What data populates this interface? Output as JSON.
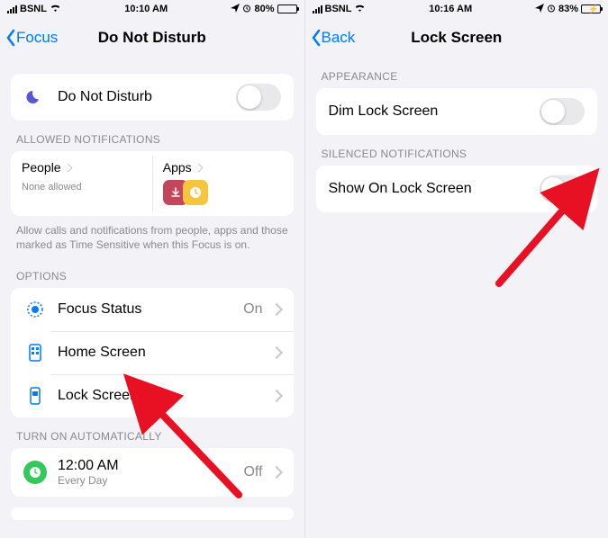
{
  "left": {
    "status": {
      "carrier": "BSNL",
      "time": "10:10 AM",
      "batt": "80%",
      "batt_fill": 80
    },
    "nav": {
      "back": "Focus",
      "title": "Do Not Disturb"
    },
    "main_toggle": {
      "label": "Do Not Disturb"
    },
    "allowed": {
      "header": "ALLOWED NOTIFICATIONS",
      "people": {
        "title": "People",
        "sub": "None allowed"
      },
      "apps": {
        "title": "Apps"
      },
      "footer": "Allow calls and notifications from people, apps and those marked as Time Sensitive when this Focus is on."
    },
    "options": {
      "header": "OPTIONS",
      "focus_status": {
        "label": "Focus Status",
        "value": "On"
      },
      "home": {
        "label": "Home Screen"
      },
      "lock": {
        "label": "Lock Screen"
      }
    },
    "auto": {
      "header": "TURN ON AUTOMATICALLY",
      "sched": {
        "label": "12:00 AM",
        "sub": "Every Day",
        "value": "Off"
      }
    }
  },
  "right": {
    "status": {
      "carrier": "BSNL",
      "time": "10:16 AM",
      "batt": "83%",
      "batt_fill": 83
    },
    "nav": {
      "back": "Back",
      "title": "Lock Screen"
    },
    "appearance": {
      "header": "APPEARANCE",
      "dim": {
        "label": "Dim Lock Screen"
      }
    },
    "silenced": {
      "header": "SILENCED NOTIFICATIONS",
      "show": {
        "label": "Show On Lock Screen"
      }
    }
  }
}
